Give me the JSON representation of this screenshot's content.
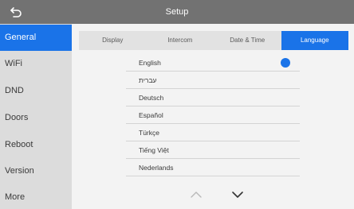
{
  "header": {
    "title": "Setup",
    "back_icon": "back-arrow-icon"
  },
  "sidebar": {
    "items": [
      {
        "label": "General",
        "active": true
      },
      {
        "label": "WiFi"
      },
      {
        "label": "DND"
      },
      {
        "label": "Doors"
      },
      {
        "label": "Reboot"
      },
      {
        "label": "Version"
      },
      {
        "label": "More"
      }
    ]
  },
  "tabs": [
    {
      "label": "Display"
    },
    {
      "label": "Intercom"
    },
    {
      "label": "Date & Time"
    },
    {
      "label": "Language",
      "active": true
    }
  ],
  "languages": [
    {
      "label": "English",
      "selected": true
    },
    {
      "label": "עברית"
    },
    {
      "label": "Deutsch"
    },
    {
      "label": "Español"
    },
    {
      "label": "Türkçe"
    },
    {
      "label": "Tiếng Việt"
    },
    {
      "label": "Nederlands"
    }
  ],
  "pager": {
    "up_icon": "chevron-up-icon",
    "down_icon": "chevron-down-icon"
  },
  "colors": {
    "accent": "#1a73e8",
    "topbar": "#727272",
    "sidebar": "#dcdcdc"
  }
}
